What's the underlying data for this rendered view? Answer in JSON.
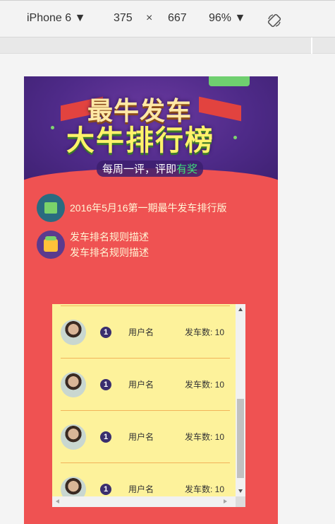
{
  "toolbar": {
    "device": "iPhone 6 ▼",
    "width": "375",
    "times": "×",
    "height": "667",
    "zoom": "96% ▼"
  },
  "banner": {
    "title_line1": "最牛发车",
    "title_line2": "大牛排行榜",
    "slogan_prefix": "每周一评，评即",
    "slogan_highlight": "有奖"
  },
  "info": {
    "period": "2016年5月16第一期最牛发车排行版",
    "rules_line1": "发车排名规则描述",
    "rules_line2": "发车排名规则描述"
  },
  "leaderboard": {
    "rows": [
      {
        "rank": "1",
        "username": "用户名",
        "count": "发车数: 10"
      },
      {
        "rank": "1",
        "username": "用户名",
        "count": "发车数: 10"
      },
      {
        "rank": "1",
        "username": "用户名",
        "count": "发车数: 10"
      },
      {
        "rank": "1",
        "username": "用户名",
        "count": "发车数: 10"
      }
    ]
  },
  "colors": {
    "page_background": "#ef5252",
    "list_background": "#fdf29b",
    "rank_badge": "#3a2e6e"
  }
}
